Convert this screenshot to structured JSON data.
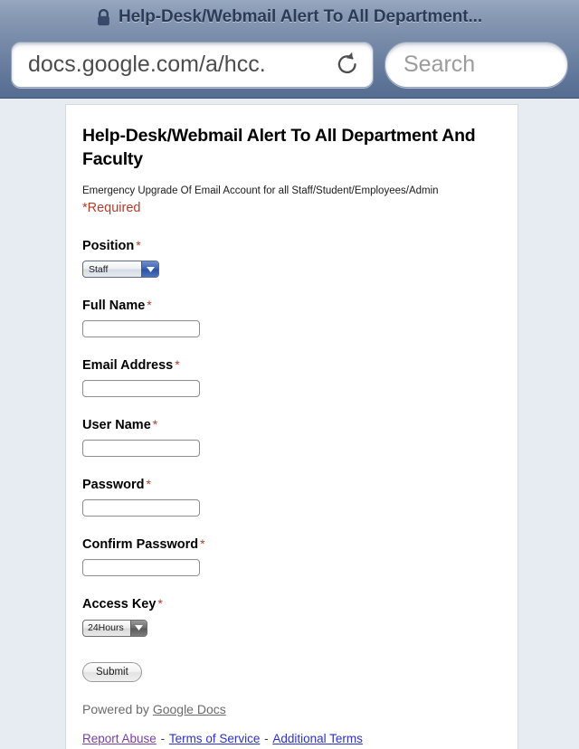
{
  "browser": {
    "lock_icon": "lock-icon",
    "page_title": "Help-Desk/Webmail Alert To All Department...",
    "url": "docs.google.com/a/hcc.",
    "reload_icon": "reload-icon",
    "search_placeholder": "Search"
  },
  "form": {
    "title": "Help-Desk/Webmail Alert To All Department And Faculty",
    "description": "Emergency Upgrade Of Email Account for all Staff/Student/Employees/Admin",
    "required_note": "*Required",
    "required_marker": "*",
    "fields": [
      {
        "label": "Position",
        "type": "select",
        "style": "blue",
        "value": "Staff",
        "required": true,
        "name": "position"
      },
      {
        "label": "Full Name",
        "type": "text",
        "value": "",
        "required": true,
        "name": "full-name"
      },
      {
        "label": "Email Address",
        "type": "text",
        "value": "",
        "required": true,
        "name": "email-address"
      },
      {
        "label": "User Name",
        "type": "text",
        "value": "",
        "required": true,
        "name": "user-name"
      },
      {
        "label": "Password",
        "type": "text",
        "value": "",
        "required": true,
        "name": "password"
      },
      {
        "label": "Confirm Password",
        "type": "text",
        "value": "",
        "required": true,
        "name": "confirm-password"
      },
      {
        "label": "Access Key",
        "type": "select",
        "style": "gray",
        "value": "24Hours",
        "required": true,
        "name": "access-key"
      }
    ],
    "submit_label": "Submit"
  },
  "footer": {
    "powered_prefix": "Powered by ",
    "powered_link": "Google Docs",
    "report_abuse": "Report Abuse",
    "separator": "-",
    "terms_of_service": "Terms of Service",
    "additional_terms": "Additional Terms"
  },
  "colors": {
    "chrome_top": "#97a7bf",
    "chrome_bottom": "#566d92",
    "page_background": "#e7ecf3",
    "card_background": "#ffffff",
    "required_red": "#a8402e",
    "link_visited": "#7a3f9d",
    "link_normal": "#2b32c8",
    "select_blue_arrow": "#2a4f9e"
  }
}
